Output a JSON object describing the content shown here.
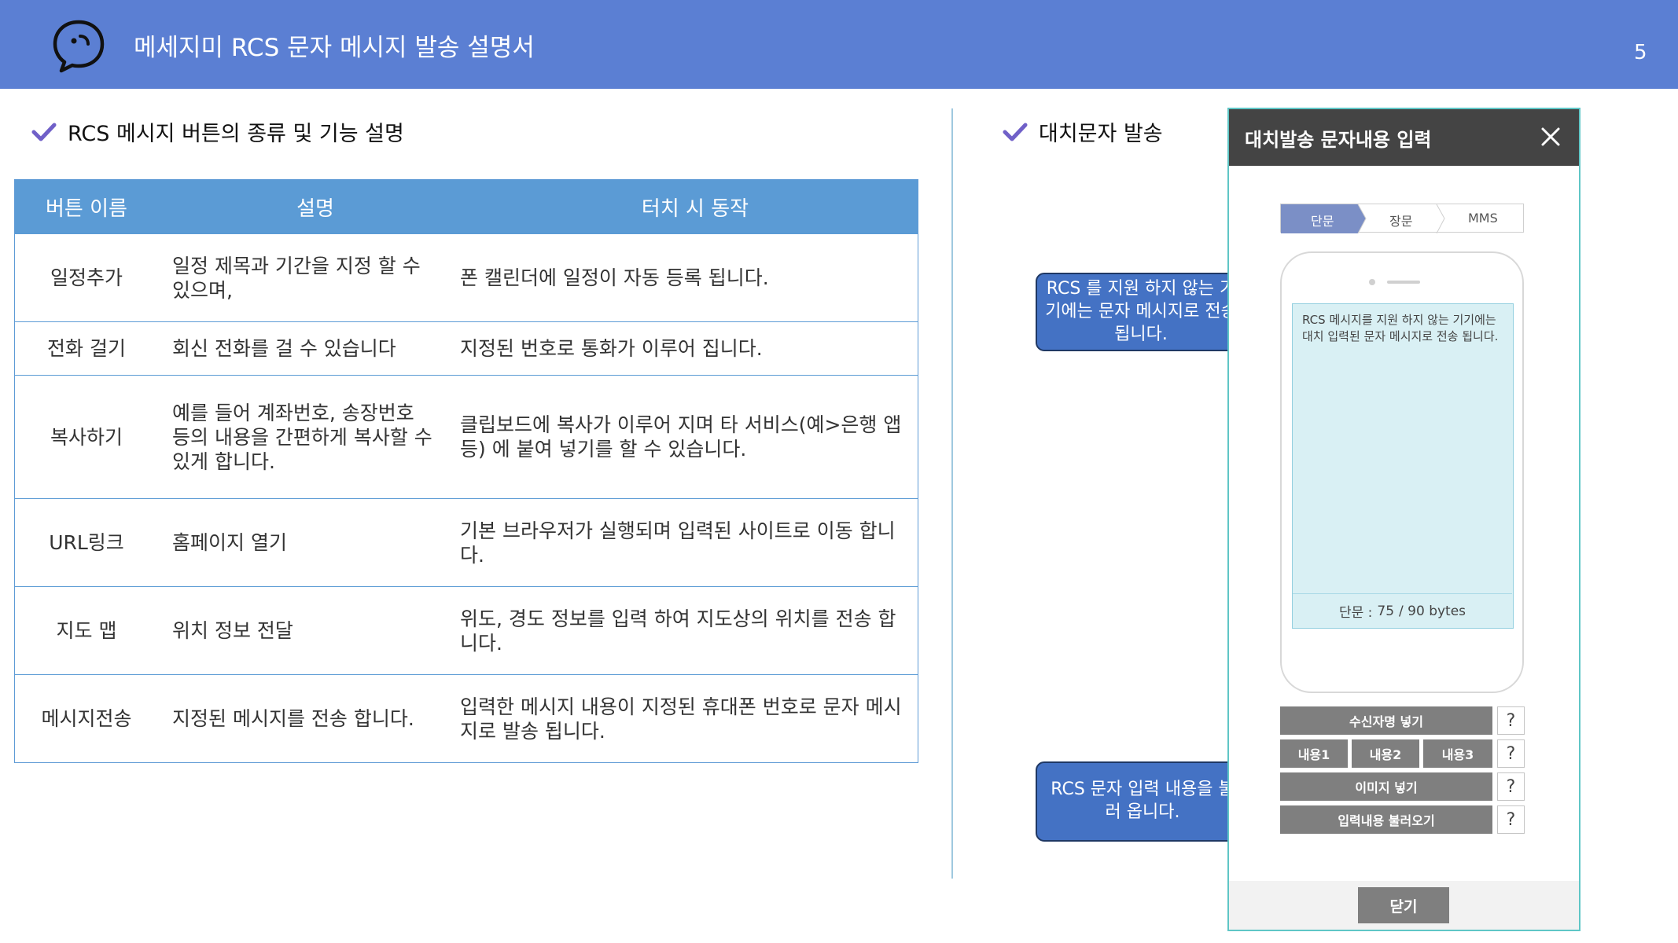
{
  "header": {
    "title": "메세지미 RCS 문자 메시지 발송 설명서",
    "page_number": "5",
    "logo_icon": "chat-bubble-icon"
  },
  "colors": {
    "header_bg": "#5b7fd3",
    "table_header_bg": "#5b9bd5",
    "table_border": "#5b9bd5",
    "callout_bg": "#4472c4",
    "callout_border": "#1f3864",
    "check_color": "#7060c8",
    "dialog_title_bg": "#444444",
    "button_gray": "#7f7f7f",
    "screen_bg": "#d9f0f4"
  },
  "left_section": {
    "heading": "RCS 메시지 버튼의 종류 및 기능 설명",
    "table": {
      "columns": [
        "버튼 이름",
        "설명",
        "터치 시 동작"
      ],
      "rows": [
        {
          "name": "일정추가",
          "desc": "일정 제목과 기간을 지정 할 수 있으며,",
          "action": "폰 캘린더에 일정이 자동 등록 됩니다."
        },
        {
          "name": "전화 걸기",
          "desc": "회신 전화를 걸 수 있습니다",
          "action": "지정된 번호로 통화가 이루어 집니다."
        },
        {
          "name": "복사하기",
          "desc": "예를 들어 계좌번호, 송장번호 등의 내용을 간편하게 복사할 수 있게 합니다.",
          "action": "클립보드에 복사가 이루어 지며 타 서비스(예>은행 앱 등) 에 붙여 넣기를 할 수 있습니다."
        },
        {
          "name": "URL링크",
          "desc": "홈페이지 열기",
          "action": "기본 브라우저가 실행되며 입력된 사이트로 이동 합니다."
        },
        {
          "name": "지도 맵",
          "desc": "위치 정보 전달",
          "action": "위도, 경도 정보를 입력 하여 지도상의 위치를 전송 합니다."
        },
        {
          "name": "메시지전송",
          "desc": "지정된 메시지를 전송 합니다.",
          "action": "입력한 메시지 내용이 지정된 휴대폰 번호로 문자 메시지로 발송 됩니다."
        }
      ]
    }
  },
  "right_section": {
    "heading": "대치문자 발송",
    "callouts": [
      "RCS 를 지원 하지 않는 기기에는 문자 메시지로 전송 됩니다.",
      "RCS 문자 입력 내용을 불러 옵니다."
    ],
    "dialog": {
      "title": "대치발송 문자내용 입력",
      "tabs": [
        "단문",
        "장문",
        "MMS"
      ],
      "active_tab": "단문",
      "message_text": "RCS 메시지를 지원 하지 않는 기기에는 대치 입력된 문자 메시지로 전송 됩니다.",
      "byte_label": "단문 :",
      "byte_count": "75",
      "byte_limit": "/ 90 bytes",
      "buttons": {
        "insert_name": "수신자명 넣기",
        "content1": "내용1",
        "content2": "내용2",
        "content3": "내용3",
        "insert_image": "이미지 넣기",
        "load_input": "입력내용 불러오기",
        "help": "?"
      },
      "close_button": "닫기"
    }
  }
}
